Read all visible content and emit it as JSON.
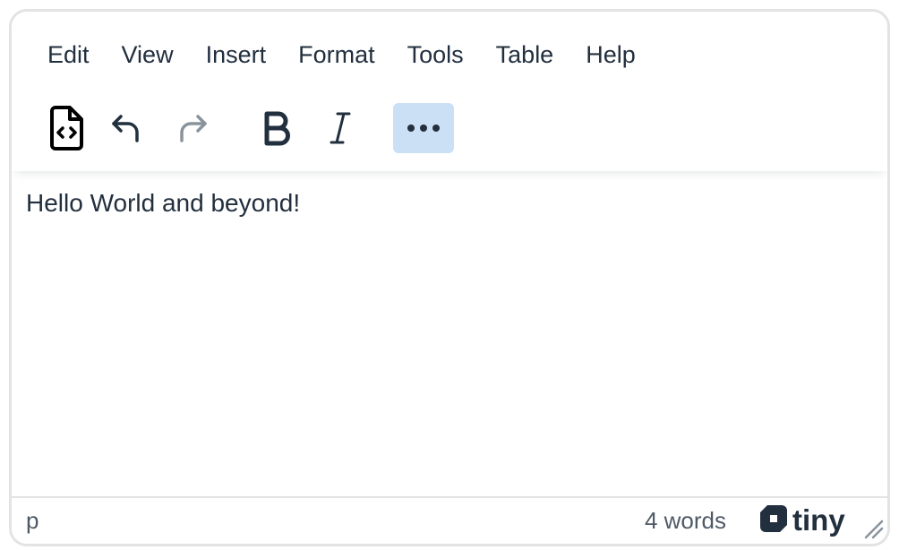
{
  "menubar": {
    "items": [
      {
        "label": "Edit"
      },
      {
        "label": "View"
      },
      {
        "label": "Insert"
      },
      {
        "label": "Format"
      },
      {
        "label": "Tools"
      },
      {
        "label": "Table"
      },
      {
        "label": "Help"
      }
    ]
  },
  "toolbar": {
    "buttons": [
      {
        "name": "source-code-icon",
        "state": "enabled"
      },
      {
        "name": "undo-icon",
        "state": "enabled"
      },
      {
        "name": "redo-icon",
        "state": "disabled"
      },
      {
        "name": "bold-icon",
        "state": "enabled"
      },
      {
        "name": "italic-icon",
        "state": "enabled"
      },
      {
        "name": "more-icon",
        "state": "active"
      }
    ]
  },
  "content": {
    "text": "Hello World and beyond!"
  },
  "statusbar": {
    "path": "p",
    "wordcount": "4 words",
    "brand": "tiny"
  },
  "colors": {
    "text": "#222f3e",
    "disabled": "#8a939c",
    "active_bg": "#cce0f5",
    "border": "#e3e3e3",
    "muted": "#4f5a66"
  }
}
